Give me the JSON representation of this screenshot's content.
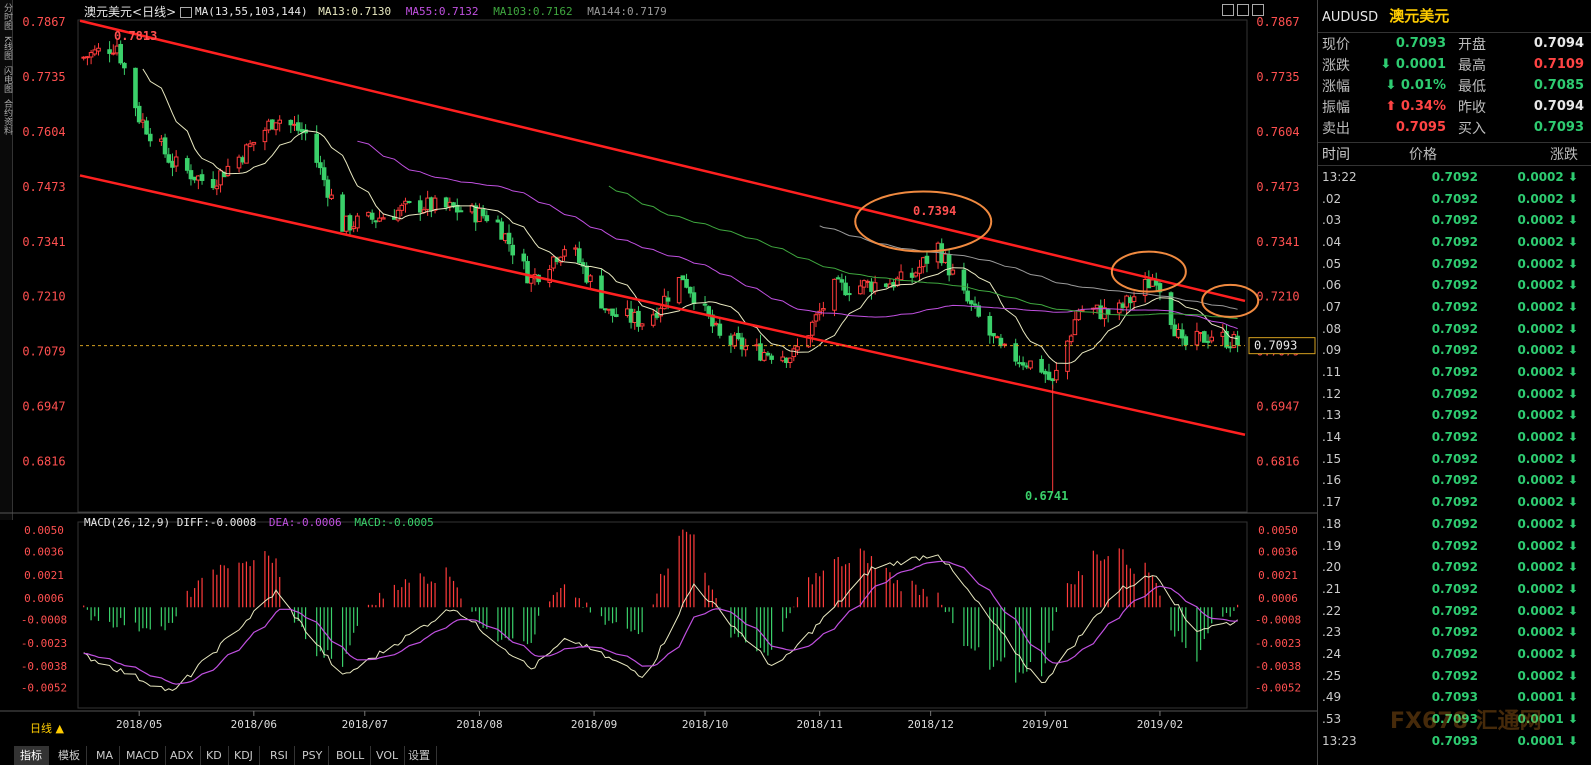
{
  "header": {
    "symbol_label": "澳元美元",
    "period_label": "<日线>",
    "ma_title": "MA(13,55,103,144)",
    "ma13": "MA13:0.7130",
    "ma55": "MA55:0.7132",
    "ma103": "MA103:0.7162",
    "ma144": "MA144:0.7179"
  },
  "left_tabs": [
    "分时图",
    "K线图",
    "闪电图",
    "合约资料"
  ],
  "price_axis": [
    "0.7867",
    "0.7735",
    "0.7604",
    "0.7473",
    "0.7341",
    "0.7210",
    "0.7079",
    "0.6947",
    "0.6816"
  ],
  "macd_axis": [
    "0.0050",
    "0.0036",
    "0.0021",
    "0.0006",
    "-0.0008",
    "-0.0023",
    "-0.0038",
    "-0.0052"
  ],
  "date_axis": [
    "2018/05",
    "2018/06",
    "2018/07",
    "2018/08",
    "2018/09",
    "2018/10",
    "2018/11",
    "2018/12",
    "2019/01",
    "2019/02"
  ],
  "macd_header": {
    "title": "MACD(26,12,9)",
    "diff": "DIFF:-0.0008",
    "dea": "DEA:-0.0006",
    "macd": "MACD:-0.0005"
  },
  "annotations": {
    "high": "0.7813",
    "mid_high": "0.7394",
    "low": "0.6741",
    "current_price_tag": "0.7093"
  },
  "quote_panel": {
    "code": "AUDUSD",
    "name": "澳元美元",
    "rows": [
      {
        "l1": "现价",
        "v1": "0.7093",
        "c1": "green",
        "l2": "开盘",
        "v2": "0.7094",
        "c2": "white"
      },
      {
        "l1": "涨跌",
        "v1": "⬇ 0.0001",
        "c1": "green",
        "l2": "最高",
        "v2": "0.7109",
        "c2": "red"
      },
      {
        "l1": "涨幅",
        "v1": "⬇ 0.01%",
        "c1": "green",
        "l2": "最低",
        "v2": "0.7085",
        "c2": "green"
      },
      {
        "l1": "振幅",
        "v1": "⬆ 0.34%",
        "c1": "red",
        "l2": "昨收",
        "v2": "0.7094",
        "c2": "white"
      },
      {
        "l1": "卖出",
        "v1": "0.7095",
        "c1": "red",
        "l2": "买入",
        "v2": "0.7093",
        "c2": "green"
      }
    ],
    "tick_header": {
      "time": "时间",
      "price": "价格",
      "change": "涨跌"
    },
    "ticks": [
      {
        "t": "13:22",
        "p": "0.7092",
        "c": "0.0002 ⬇"
      },
      {
        "t": ".02",
        "p": "0.7092",
        "c": "0.0002 ⬇"
      },
      {
        "t": ".03",
        "p": "0.7092",
        "c": "0.0002 ⬇"
      },
      {
        "t": ".04",
        "p": "0.7092",
        "c": "0.0002 ⬇"
      },
      {
        "t": ".05",
        "p": "0.7092",
        "c": "0.0002 ⬇"
      },
      {
        "t": ".06",
        "p": "0.7092",
        "c": "0.0002 ⬇"
      },
      {
        "t": ".07",
        "p": "0.7092",
        "c": "0.0002 ⬇"
      },
      {
        "t": ".08",
        "p": "0.7092",
        "c": "0.0002 ⬇"
      },
      {
        "t": ".09",
        "p": "0.7092",
        "c": "0.0002 ⬇"
      },
      {
        "t": ".11",
        "p": "0.7092",
        "c": "0.0002 ⬇"
      },
      {
        "t": ".12",
        "p": "0.7092",
        "c": "0.0002 ⬇"
      },
      {
        "t": ".13",
        "p": "0.7092",
        "c": "0.0002 ⬇"
      },
      {
        "t": ".14",
        "p": "0.7092",
        "c": "0.0002 ⬇"
      },
      {
        "t": ".15",
        "p": "0.7092",
        "c": "0.0002 ⬇"
      },
      {
        "t": ".16",
        "p": "0.7092",
        "c": "0.0002 ⬇"
      },
      {
        "t": ".17",
        "p": "0.7092",
        "c": "0.0002 ⬇"
      },
      {
        "t": ".18",
        "p": "0.7092",
        "c": "0.0002 ⬇"
      },
      {
        "t": ".19",
        "p": "0.7092",
        "c": "0.0002 ⬇"
      },
      {
        "t": ".20",
        "p": "0.7092",
        "c": "0.0002 ⬇"
      },
      {
        "t": ".21",
        "p": "0.7092",
        "c": "0.0002 ⬇"
      },
      {
        "t": ".22",
        "p": "0.7092",
        "c": "0.0002 ⬇"
      },
      {
        "t": ".23",
        "p": "0.7092",
        "c": "0.0002 ⬇"
      },
      {
        "t": ".24",
        "p": "0.7092",
        "c": "0.0002 ⬇"
      },
      {
        "t": ".25",
        "p": "0.7092",
        "c": "0.0002 ⬇"
      },
      {
        "t": ".49",
        "p": "0.7093",
        "c": "0.0001 ⬇"
      },
      {
        "t": ".53",
        "p": "0.7093",
        "c": "0.0001 ⬇"
      },
      {
        "t": "13:23",
        "p": "0.7093",
        "c": "0.0001 ⬇"
      }
    ]
  },
  "bottom_tabs": [
    "日线 ▲",
    "指标",
    "模板",
    "MA",
    "MACD",
    "ADX",
    "KD",
    "KDJ",
    "RSI",
    "PSY",
    "BOLL",
    "VOL",
    "设置"
  ],
  "watermark": "FX678 汇通网",
  "colors": {
    "up": "#ff3b3b",
    "down": "#3ad06a",
    "ma13": "#e8e8c0",
    "ma55": "#c050e0",
    "ma103": "#3fa83f",
    "ma144": "#9a9a9a",
    "channel": "#ff2020",
    "circle": "#f08a40",
    "diff": "#e8e8c0",
    "dea": "#c050e0"
  },
  "chart_data": {
    "type": "candlestick",
    "title": "澳元美元 <日线>",
    "ylim": [
      0.67,
      0.7867
    ],
    "macd_ylim": [
      -0.006,
      0.005
    ],
    "price_anchors": [
      {
        "date": "2018/04/15",
        "price": 0.778
      },
      {
        "date": "2018/04/25",
        "price": 0.7813
      },
      {
        "date": "2018/05/01",
        "price": 0.764
      },
      {
        "date": "2018/05/10",
        "price": 0.753
      },
      {
        "date": "2018/05/20",
        "price": 0.748
      },
      {
        "date": "2018/05/30",
        "price": 0.756
      },
      {
        "date": "2018/06/07",
        "price": 0.764
      },
      {
        "date": "2018/06/15",
        "price": 0.76
      },
      {
        "date": "2018/06/25",
        "price": 0.738
      },
      {
        "date": "2018/07/05",
        "price": 0.74
      },
      {
        "date": "2018/07/15",
        "price": 0.743
      },
      {
        "date": "2018/07/25",
        "price": 0.742
      },
      {
        "date": "2018/08/05",
        "price": 0.74
      },
      {
        "date": "2018/08/15",
        "price": 0.725
      },
      {
        "date": "2018/08/25",
        "price": 0.734
      },
      {
        "date": "2018/09/05",
        "price": 0.717
      },
      {
        "date": "2018/09/15",
        "price": 0.715
      },
      {
        "date": "2018/09/25",
        "price": 0.726
      },
      {
        "date": "2018/10/05",
        "price": 0.711
      },
      {
        "date": "2018/10/15",
        "price": 0.708
      },
      {
        "date": "2018/10/25",
        "price": 0.707
      },
      {
        "date": "2018/11/05",
        "price": 0.723
      },
      {
        "date": "2018/11/15",
        "price": 0.724
      },
      {
        "date": "2018/11/25",
        "price": 0.725
      },
      {
        "date": "2018/12/03",
        "price": 0.733
      },
      {
        "date": "2018/12/10",
        "price": 0.721
      },
      {
        "date": "2018/12/20",
        "price": 0.708
      },
      {
        "date": "2018/12/31",
        "price": 0.704
      },
      {
        "date": "2019/01/03",
        "price": 0.7
      },
      {
        "date": "2019/01/10",
        "price": 0.718
      },
      {
        "date": "2019/01/20",
        "price": 0.717
      },
      {
        "date": "2019/01/31",
        "price": 0.726
      },
      {
        "date": "2019/02/07",
        "price": 0.709
      },
      {
        "date": "2019/02/15",
        "price": 0.712
      },
      {
        "date": "2019/02/24",
        "price": 0.7093
      }
    ],
    "channel_upper": [
      {
        "date": "2018/04/15",
        "price": 0.787
      },
      {
        "date": "2019/02/24",
        "price": 0.72
      }
    ],
    "channel_lower": [
      {
        "date": "2018/04/15",
        "price": 0.75
      },
      {
        "date": "2019/02/24",
        "price": 0.688
      }
    ],
    "wick_low": {
      "date": "2019/01/03",
      "price": 0.6741
    },
    "circles": [
      {
        "date": "2018/11/29",
        "price": 0.739
      },
      {
        "date": "2019/01/29",
        "price": 0.727
      },
      {
        "date": "2019/02/20",
        "price": 0.72
      }
    ],
    "current_price": 0.7093,
    "macd_anchors": [
      {
        "date": "2018/04/15",
        "value": -0.003
      },
      {
        "date": "2018/05/10",
        "value": -0.0055
      },
      {
        "date": "2018/06/07",
        "value": 0.001
      },
      {
        "date": "2018/06/25",
        "value": -0.0045
      },
      {
        "date": "2018/07/25",
        "value": 0.0
      },
      {
        "date": "2018/08/15",
        "value": -0.004
      },
      {
        "date": "2018/08/25",
        "value": -0.002
      },
      {
        "date": "2018/09/15",
        "value": -0.0045
      },
      {
        "date": "2018/09/28",
        "value": 0.0015
      },
      {
        "date": "2018/10/20",
        "value": -0.004
      },
      {
        "date": "2018/11/15",
        "value": 0.0025
      },
      {
        "date": "2018/12/03",
        "value": 0.0035
      },
      {
        "date": "2018/12/31",
        "value": -0.005
      },
      {
        "date": "2019/01/20",
        "value": 0.001
      },
      {
        "date": "2019/01/31",
        "value": 0.0022
      },
      {
        "date": "2019/02/10",
        "value": -0.0015
      },
      {
        "date": "2019/02/24",
        "value": -0.0008
      }
    ]
  }
}
